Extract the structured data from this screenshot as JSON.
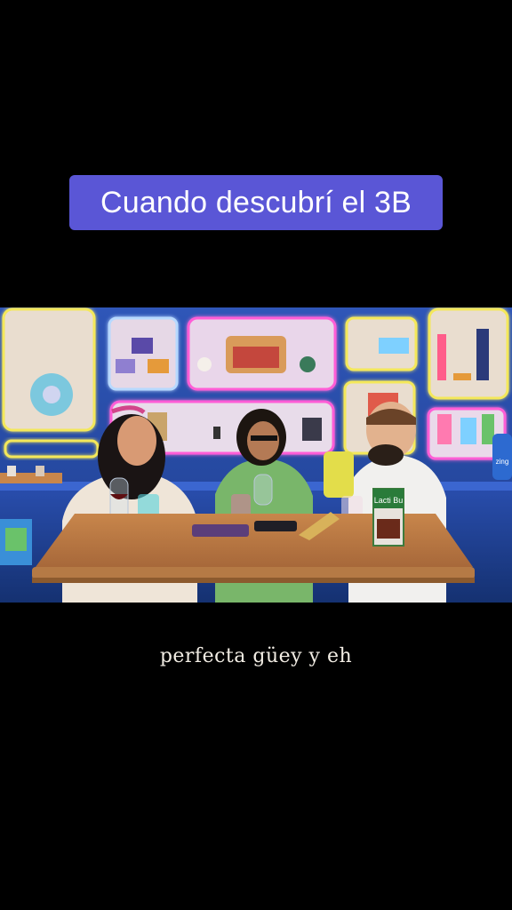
{
  "caption": {
    "text": "Cuando descubrí el 3B"
  },
  "scene": {
    "props": {
      "juice_box_text": "Lacti Bu",
      "right_bottle_text": "zing"
    }
  },
  "subtitle": {
    "text": "perfecta güey y eh"
  },
  "colors": {
    "caption_bg": "#5a56d6",
    "background": "#000000",
    "wall": "#2d4fa8",
    "table": "#b9763f",
    "neon_yellow": "#f4e85a",
    "neon_pink": "#ff5dd6",
    "neon_blue": "#79c8ff"
  }
}
